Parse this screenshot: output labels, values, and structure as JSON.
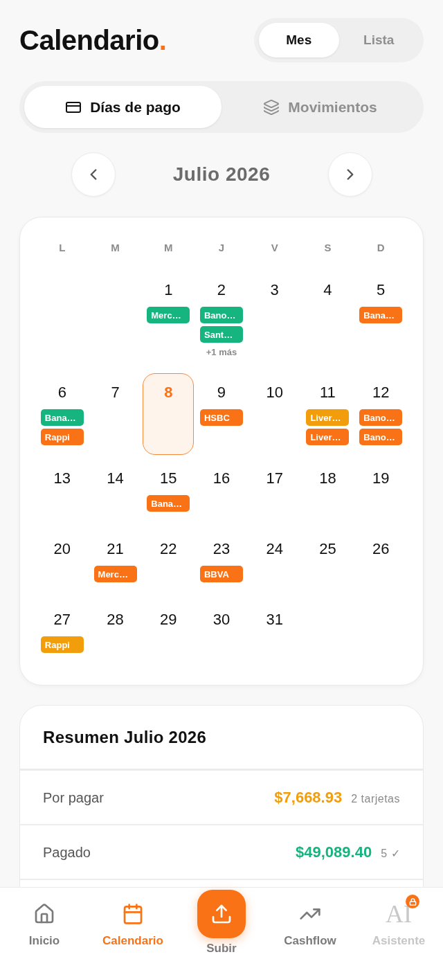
{
  "header": {
    "title": "Calendario",
    "title_dot": ".",
    "view_toggle": [
      {
        "label": "Mes",
        "selected": true
      },
      {
        "label": "Lista",
        "selected": false
      }
    ]
  },
  "mode_tabs": [
    {
      "label": "Días de pago",
      "selected": true
    },
    {
      "label": "Movimientos",
      "selected": false
    }
  ],
  "month_nav": {
    "title": "Julio 2026"
  },
  "calendar": {
    "weekdays": [
      "L",
      "M",
      "M",
      "J",
      "V",
      "S",
      "D"
    ],
    "weeks": [
      [
        {
          "day": "1",
          "today": false,
          "payments": [
            {
              "label": "Merc…",
              "color": "#16b47f"
            }
          ]
        },
        {
          "day": "2",
          "today": false,
          "payments": [
            {
              "label": "Bano…",
              "color": "#16b47f"
            },
            {
              "label": "Sant…",
              "color": "#16b47f"
            }
          ],
          "more": "+1 más"
        },
        {
          "day": "3",
          "today": false
        },
        {
          "day": "4",
          "today": false
        },
        {
          "day": "5",
          "today": false,
          "payments": [
            {
              "label": "Bana…",
              "color": "#f97316"
            }
          ]
        }
      ],
      [
        {
          "day": "6",
          "today": false,
          "payments": [
            {
              "label": "Bana…",
              "color": "#16b47f"
            },
            {
              "label": "Rappi",
              "color": "#f97316"
            }
          ]
        },
        {
          "day": "7",
          "today": false
        },
        {
          "day": "8",
          "today": true
        },
        {
          "day": "9",
          "today": false,
          "payments": [
            {
              "label": "HSBC",
              "color": "#f97316"
            }
          ]
        },
        {
          "day": "10",
          "today": false
        },
        {
          "day": "11",
          "today": false,
          "payments": [
            {
              "label": "Liver…",
              "color": "#f29e0c"
            },
            {
              "label": "Liver…",
              "color": "#f97316"
            }
          ]
        },
        {
          "day": "12",
          "today": false,
          "payments": [
            {
              "label": "Bano…",
              "color": "#f97316"
            },
            {
              "label": "Bano…",
              "color": "#f97316"
            }
          ]
        }
      ],
      [
        {
          "day": "13",
          "today": false
        },
        {
          "day": "14",
          "today": false
        },
        {
          "day": "15",
          "today": false,
          "payments": [
            {
              "label": "Bana…",
              "color": "#f97316"
            }
          ]
        },
        {
          "day": "16",
          "today": false
        },
        {
          "day": "17",
          "today": false
        },
        {
          "day": "18",
          "today": false
        },
        {
          "day": "19",
          "today": false
        }
      ],
      [
        {
          "day": "20",
          "today": false
        },
        {
          "day": "21",
          "today": false,
          "payments": [
            {
              "label": "Merc…",
              "color": "#f97316"
            }
          ]
        },
        {
          "day": "22",
          "today": false
        },
        {
          "day": "23",
          "today": false,
          "payments": [
            {
              "label": "BBVA",
              "color": "#f97316"
            }
          ]
        },
        {
          "day": "24",
          "today": false
        },
        {
          "day": "25",
          "today": false
        },
        {
          "day": "26",
          "today": false
        }
      ],
      [
        {
          "day": "27",
          "today": false,
          "payments": [
            {
              "label": "Rappi",
              "color": "#f29e0c"
            }
          ]
        },
        {
          "day": "28",
          "today": false
        },
        {
          "day": "29",
          "today": false
        },
        {
          "day": "30",
          "today": false
        },
        {
          "day": "31",
          "today": false
        }
      ]
    ]
  },
  "summary": {
    "title": "Resumen Julio 2026",
    "rows": [
      {
        "label": "Por pagar",
        "amount": "$7,668.93",
        "color": "#f29e0c",
        "note": "2 tarjetas"
      },
      {
        "label": "Pagado",
        "amount": "$49,089.40",
        "color": "#16b47f",
        "note": "5 ✓"
      }
    ]
  },
  "bottom_nav": [
    {
      "kind": "tab",
      "label": "Inicio",
      "selected": false,
      "locked": false
    },
    {
      "kind": "tab",
      "label": "Calendario",
      "selected": true,
      "locked": false
    },
    {
      "kind": "action",
      "label": "Subir",
      "selected": false,
      "locked": false
    },
    {
      "kind": "tab",
      "label": "Cashflow",
      "selected": false,
      "locked": false
    },
    {
      "kind": "tab",
      "label": "Asistente",
      "selected": false,
      "locked": true,
      "glyph": "AI"
    }
  ]
}
